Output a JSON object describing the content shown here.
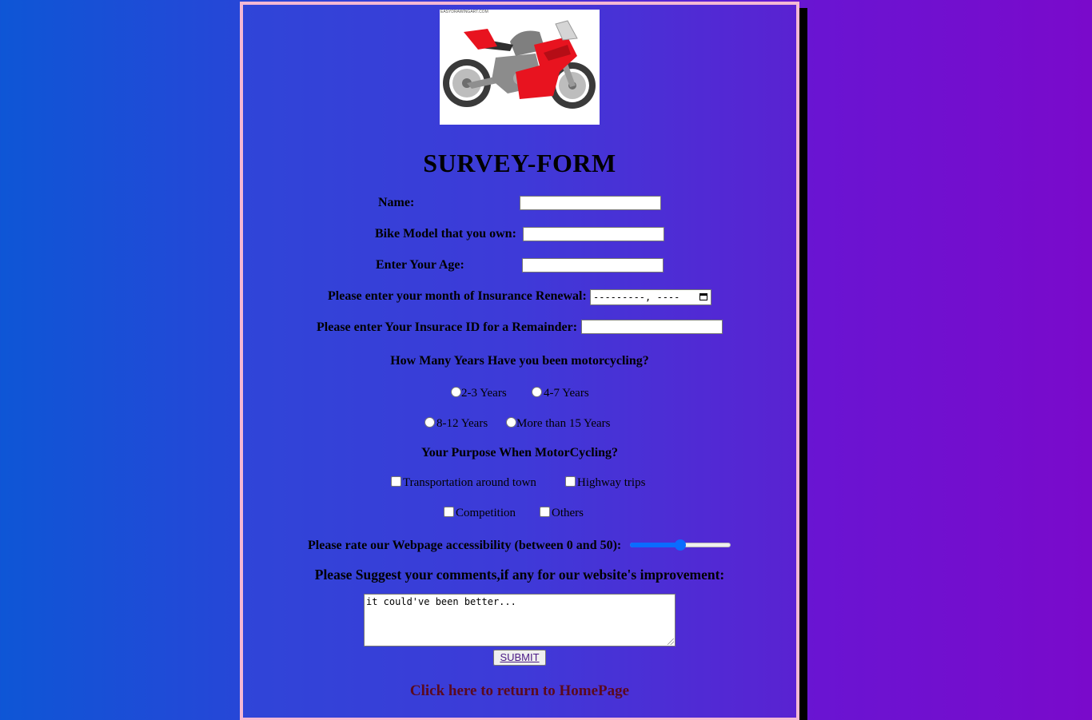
{
  "logo": {
    "watermark": "EASYDRAWINGART.COM",
    "image_name": "motorcycle-icon"
  },
  "title": "SURVEY-FORM",
  "fields": {
    "name_label": "Name:",
    "bike_label": "Bike Model that you own:",
    "age_label": "Enter Your Age:",
    "renewal_label": "Please enter your month of Insurance Renewal:",
    "renewal_value": "---------, ----",
    "insurance_label": "Please enter Your Insurace ID for a Remainder:"
  },
  "years": {
    "question": "How Many Years Have you been motorcycling?",
    "options": [
      "2-3 Years",
      "4-7 Years",
      "8-12 Years",
      "More than 15 Years"
    ]
  },
  "purpose": {
    "question": "Your Purpose When MotorCycling?",
    "options": [
      "Transportation around town",
      "Highway trips",
      "Competition",
      "Others"
    ]
  },
  "rating": {
    "label": "Please rate our Webpage accessibility (between 0 and 50):",
    "value": 25,
    "min": 0,
    "max": 50
  },
  "comments": {
    "label": "Please Suggest your comments,if any for our website's improvement:",
    "value": "it could've been better..."
  },
  "submit_label": "SUBMIT",
  "home_link": "Click here to return to HomePage",
  "colors": {
    "panel_border": "#f4b8d4",
    "slider_accent": "#0a6cff",
    "home_link": "#5a0a1e"
  }
}
